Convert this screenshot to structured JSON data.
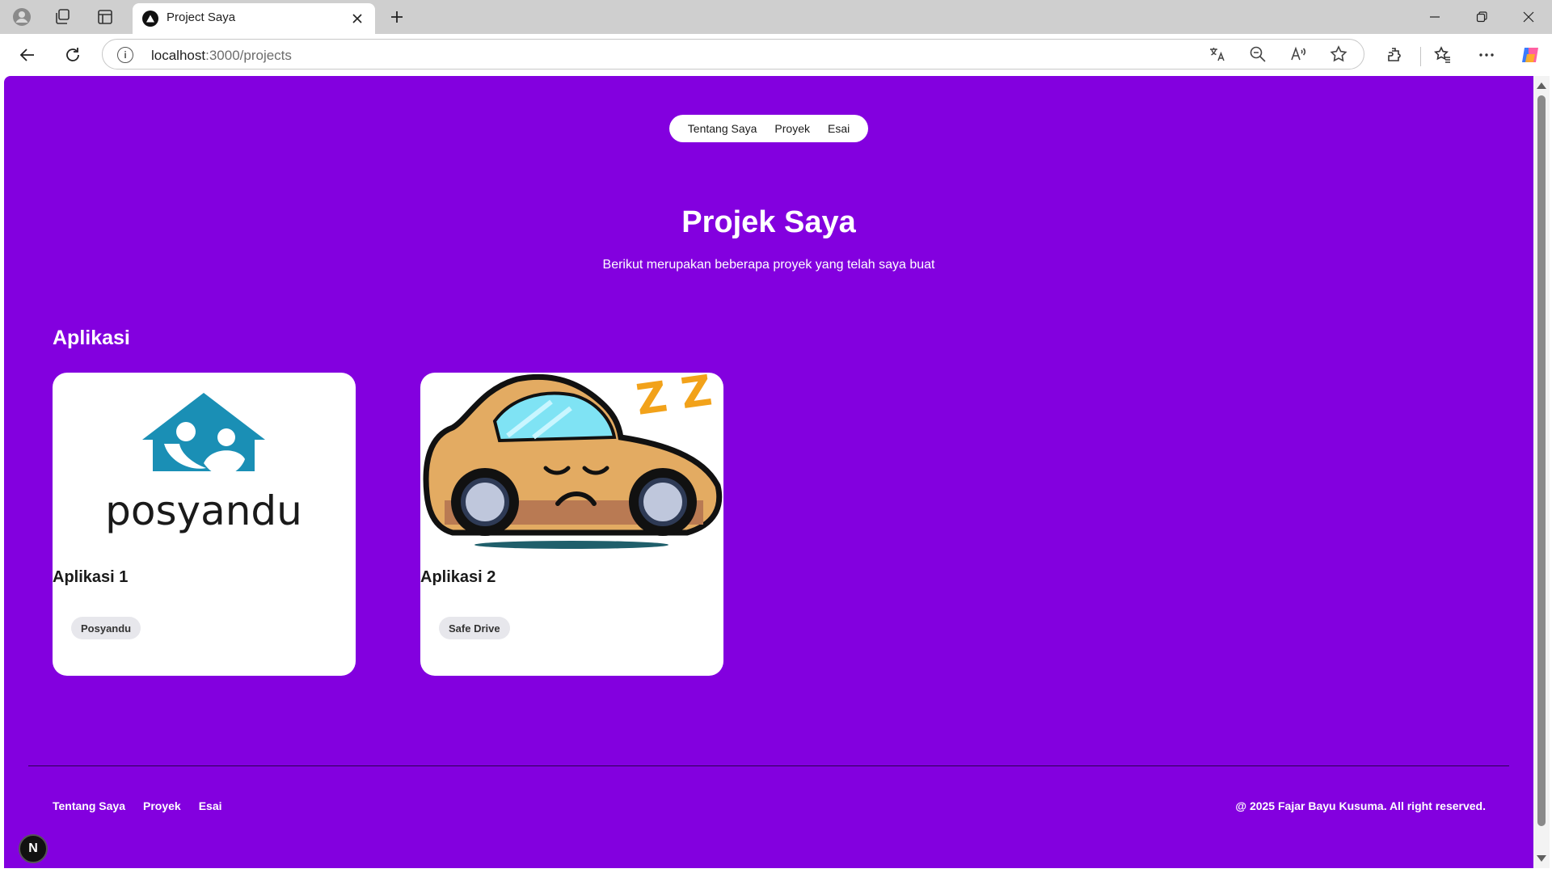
{
  "browser": {
    "tab_title": "Project Saya",
    "url_host": "localhost",
    "url_rest": ":3000/projects",
    "colors": {
      "tabbar": "#cfcfcf",
      "toolbar": "#ffffff"
    }
  },
  "nav": {
    "items": [
      "Tentang Saya",
      "Proyek",
      "Esai"
    ]
  },
  "hero": {
    "title": "Projek Saya",
    "subtitle": "Berikut merupakan beberapa proyek yang telah saya buat"
  },
  "section": {
    "title": "Aplikasi",
    "cards": [
      {
        "title": "Aplikasi 1",
        "tag": "Posyandu",
        "image_text": "posyandu",
        "image_icon": "posyandu-logo-icon"
      },
      {
        "title": "Aplikasi 2",
        "tag": "Safe Drive",
        "image_text": "Z Z",
        "image_icon": "sleepy-car-icon"
      }
    ]
  },
  "footer": {
    "links": [
      "Tentang Saya",
      "Proyek",
      "Esai"
    ],
    "copyright": "@ 2025 Fajar Bayu Kusuma. All right reserved.",
    "badge": "N"
  },
  "colors": {
    "page_background": "#8300df",
    "card_background": "#ffffff",
    "logo_teal": "#1a8fb5",
    "tag_background": "#e7e7ec"
  }
}
